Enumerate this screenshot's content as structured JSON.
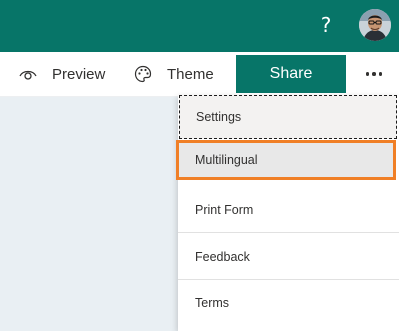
{
  "header": {
    "help_label": "?",
    "help_icon": "question-icon",
    "avatar_icon": "user-avatar"
  },
  "toolbar": {
    "preview_label": "Preview",
    "preview_icon": "eye-icon",
    "theme_label": "Theme",
    "theme_icon": "palette-icon",
    "share_label": "Share",
    "more_icon": "ellipsis-icon"
  },
  "menu": {
    "items": [
      {
        "label": "Settings",
        "state": "focused"
      },
      {
        "label": "Multilingual",
        "state": "highlighted"
      },
      {
        "label": "Print Form"
      },
      {
        "label": "Feedback"
      },
      {
        "label": "Terms"
      }
    ]
  },
  "colors": {
    "brand": "#077568",
    "highlight_border": "#f07f26",
    "page_background": "#e9eff3"
  }
}
